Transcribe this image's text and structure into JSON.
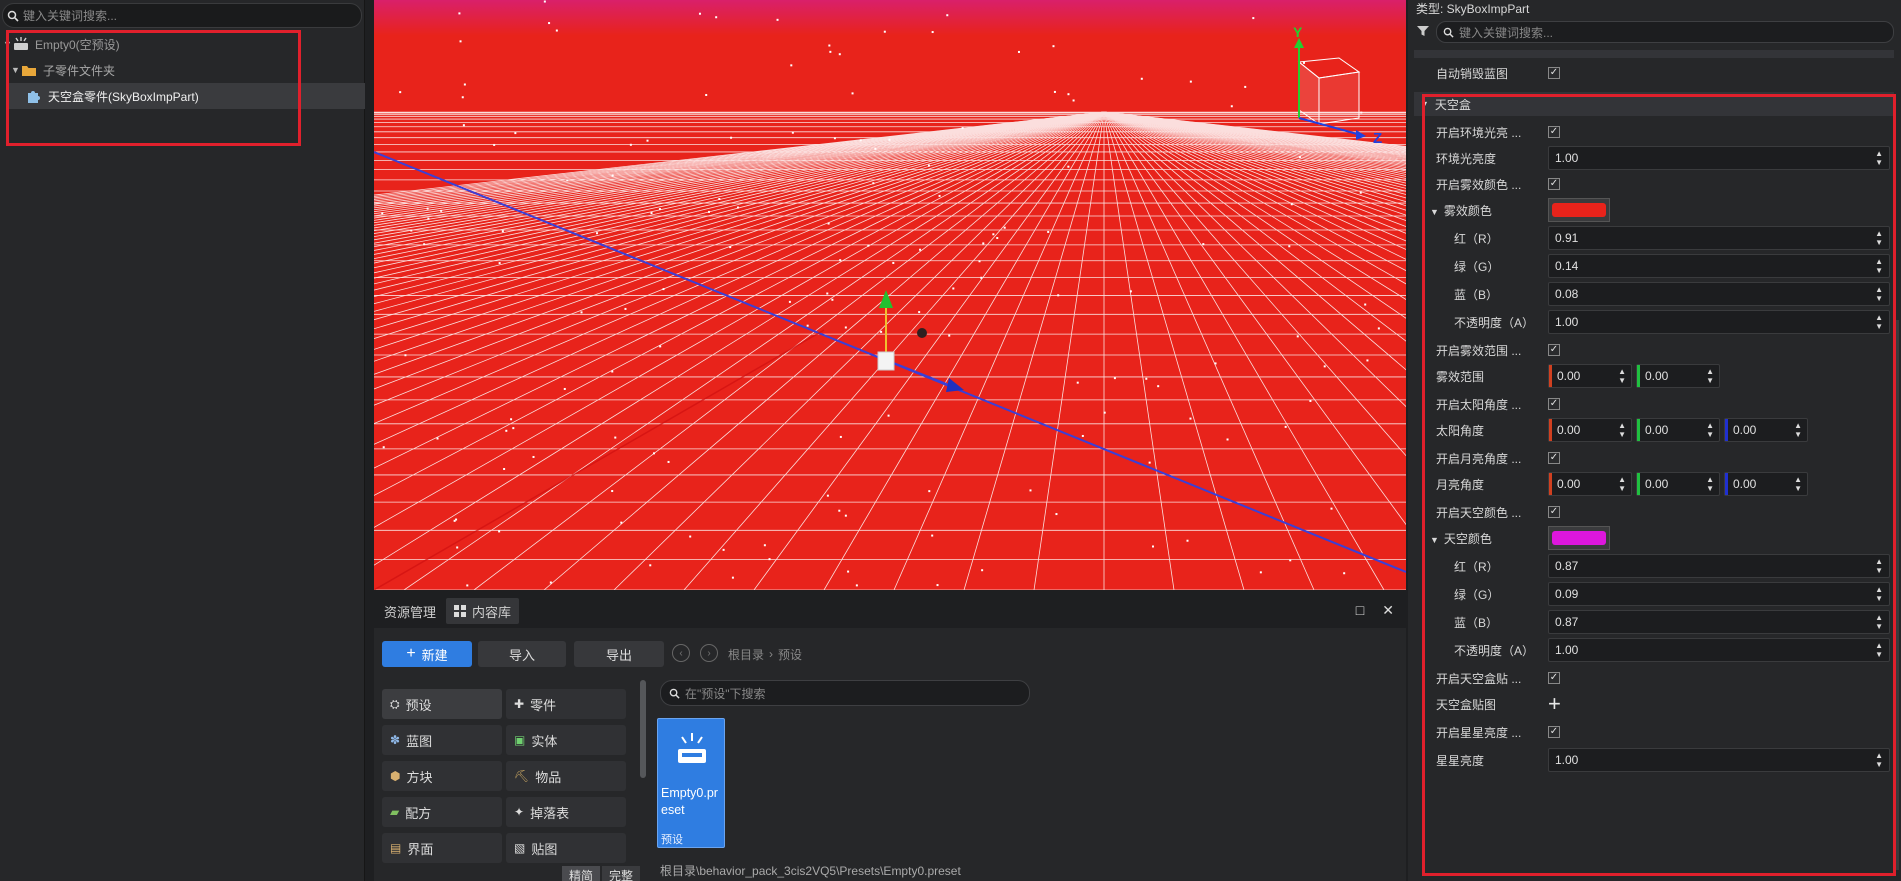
{
  "left_panel": {
    "search_placeholder": "键入关键词搜索...",
    "tree": [
      {
        "label": "Empty0(空预设)",
        "level": 0
      },
      {
        "label": "子零件文件夹",
        "level": 1
      },
      {
        "label": "天空盒零件(SkyBoxImpPart)",
        "level": 2
      }
    ]
  },
  "viewport": {
    "gizmo_y": "Y",
    "gizmo_z": "Z",
    "background_color": "#e8231b"
  },
  "bottom_panel": {
    "tabs": [
      "资源管理",
      "内容库"
    ],
    "window_controls": [
      "□",
      "✕"
    ],
    "toolbar": {
      "new": "新建",
      "import": "导入",
      "export": "导出"
    },
    "breadcrumb": [
      "根目录",
      "预设"
    ],
    "categories": [
      {
        "label": "预设",
        "icon": "preset-icon"
      },
      {
        "label": "零件",
        "icon": "part-icon"
      },
      {
        "label": "蓝图",
        "icon": "blueprint-icon"
      },
      {
        "label": "实体",
        "icon": "entity-icon"
      },
      {
        "label": "方块",
        "icon": "block-icon"
      },
      {
        "label": "物品",
        "icon": "item-icon"
      },
      {
        "label": "配方",
        "icon": "recipe-icon"
      },
      {
        "label": "掉落表",
        "icon": "loot-icon"
      },
      {
        "label": "界面",
        "icon": "ui-icon"
      },
      {
        "label": "贴图",
        "icon": "texture-icon"
      }
    ],
    "content_search_placeholder": "在\"预设\"下搜索",
    "asset": {
      "name": "Empty0.preset",
      "type": "预设"
    },
    "view_tabs": [
      "精简",
      "完整"
    ],
    "status_path": "根目录\\behavior_pack_3cis2VQ5\\Presets\\Empty0.preset"
  },
  "right_panel": {
    "type_label": "类型: SkyBoxImpPart",
    "search_placeholder": "键入关键词搜索...",
    "auto_destroy_label": "自动销毁蓝图",
    "section_title": "天空盒",
    "properties": {
      "ambient_enable": "开启环境光亮 ...",
      "ambient_brightness_label": "环境光亮度",
      "ambient_brightness": "1.00",
      "fog_color_enable": "开启雾效颜色 ...",
      "fog_color_label": "雾效颜色",
      "fog_color_hex": "#e8231b",
      "fog_r_label": "红（R）",
      "fog_r": "0.91",
      "fog_g_label": "绿（G）",
      "fog_g": "0.14",
      "fog_b_label": "蓝（B）",
      "fog_b": "0.08",
      "fog_a_label": "不透明度（A）",
      "fog_a": "1.00",
      "fog_range_enable": "开启雾效范围 ...",
      "fog_range_label": "雾效范围",
      "fog_range": [
        "0.00",
        "0.00"
      ],
      "sun_angle_enable": "开启太阳角度 ...",
      "sun_angle_label": "太阳角度",
      "sun_angle": [
        "0.00",
        "0.00",
        "0.00"
      ],
      "moon_angle_enable": "开启月亮角度 ...",
      "moon_angle_label": "月亮角度",
      "moon_angle": [
        "0.00",
        "0.00",
        "0.00"
      ],
      "sky_color_enable": "开启天空颜色 ...",
      "sky_color_label": "天空颜色",
      "sky_color_hex": "#dd17dd",
      "sky_r_label": "红（R）",
      "sky_r": "0.87",
      "sky_g_label": "绿（G）",
      "sky_g": "0.09",
      "sky_b_label": "蓝（B）",
      "sky_b": "0.87",
      "sky_a_label": "不透明度（A）",
      "sky_a": "1.00",
      "skybox_tex_enable": "开启天空盒贴 ...",
      "skybox_tex_label": "天空盒贴图",
      "star_enable": "开启星星亮度 ...",
      "star_brightness_label": "星星亮度",
      "star_brightness": "1.00"
    }
  }
}
